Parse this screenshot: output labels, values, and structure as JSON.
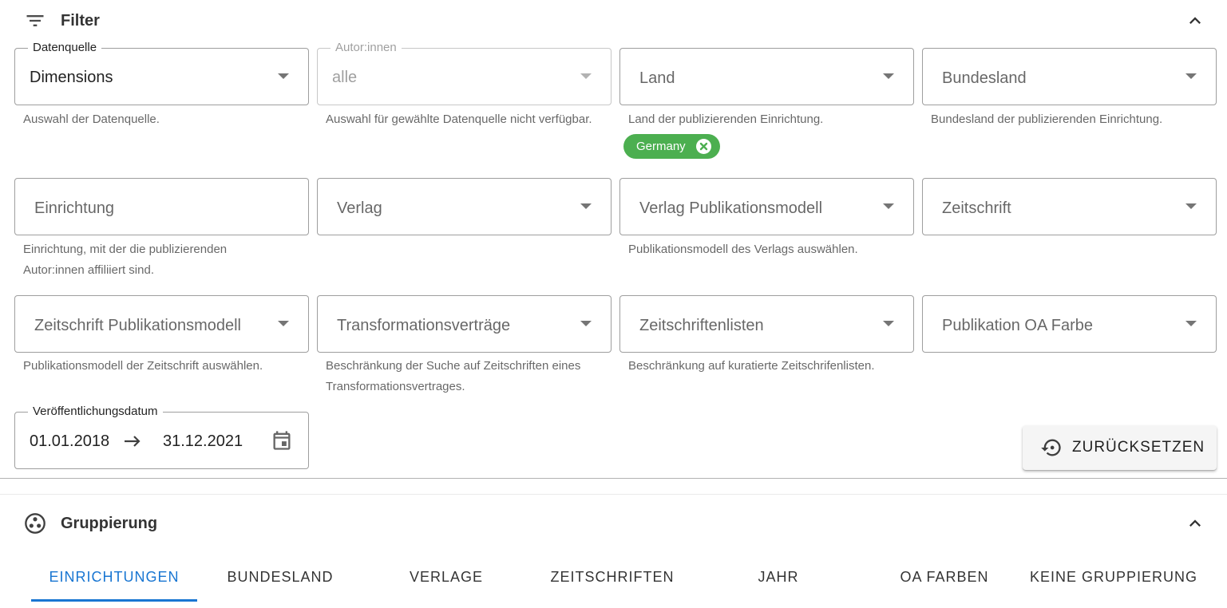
{
  "filter": {
    "title": "Filter",
    "fields": {
      "datenquelle": {
        "label": "Datenquelle",
        "value": "Dimensions",
        "hint": "Auswahl der Datenquelle."
      },
      "autorinnen": {
        "label": "Autor:innen",
        "value": "alle",
        "hint": "Auswahl für gewählte Datenquelle nicht verfügbar."
      },
      "land": {
        "placeholder": "Land",
        "hint": "Land der publizierenden Einrichtung.",
        "chip": "Germany"
      },
      "bundesland": {
        "placeholder": "Bundesland",
        "hint": "Bundesland der publizierenden Einrichtung."
      },
      "einrichtung": {
        "placeholder": "Einrichtung",
        "hint": "Einrichtung, mit der die publizierenden Autor:innen affiliiert sind."
      },
      "verlag": {
        "placeholder": "Verlag"
      },
      "verlag_modell": {
        "placeholder": "Verlag Publikationsmodell",
        "hint": "Publikationsmodell des Verlags auswählen."
      },
      "zeitschrift": {
        "placeholder": "Zeitschrift"
      },
      "zeitschrift_modell": {
        "placeholder": "Zeitschrift Publikationsmodell",
        "hint": "Publikationsmodell der Zeitschrift auswählen."
      },
      "transformation": {
        "placeholder": "Transformationsverträge",
        "hint": "Beschränkung der Suche auf Zeitschriften eines Transformationsvertrages."
      },
      "zeitschriftenlisten": {
        "placeholder": "Zeitschriftenlisten",
        "hint": "Beschränkung auf kuratierte Zeitschrifenlisten."
      },
      "oa_farbe": {
        "placeholder": "Publikation OA Farbe"
      },
      "datum": {
        "label": "Veröffentlichungsdatum",
        "start": "01.01.2018",
        "end": "31.12.2021"
      }
    },
    "reset_label": "ZURÜCKSETZEN"
  },
  "grouping": {
    "title": "Gruppierung",
    "tabs": [
      {
        "label": "EINRICHTUNGEN",
        "active": true
      },
      {
        "label": "BUNDESLAND"
      },
      {
        "label": "VERLAGE"
      },
      {
        "label": "ZEITSCHRIFTEN"
      },
      {
        "label": "JAHR"
      },
      {
        "label": "OA FARBEN"
      },
      {
        "label": "KEINE GRUPPIERUNG"
      }
    ]
  },
  "icons": {
    "filter": "filter-list-icon",
    "chevron": "chevron-up-icon",
    "dropdown": "arrow-drop-down-icon",
    "chip_remove": "cancel-circle-icon",
    "date_arrow": "arrow-right-icon",
    "calendar": "calendar-icon",
    "reset": "history-restore-icon",
    "grouping": "workspaces-icon"
  },
  "colors": {
    "primary": "#1976d2",
    "chip": "#4caf50"
  }
}
